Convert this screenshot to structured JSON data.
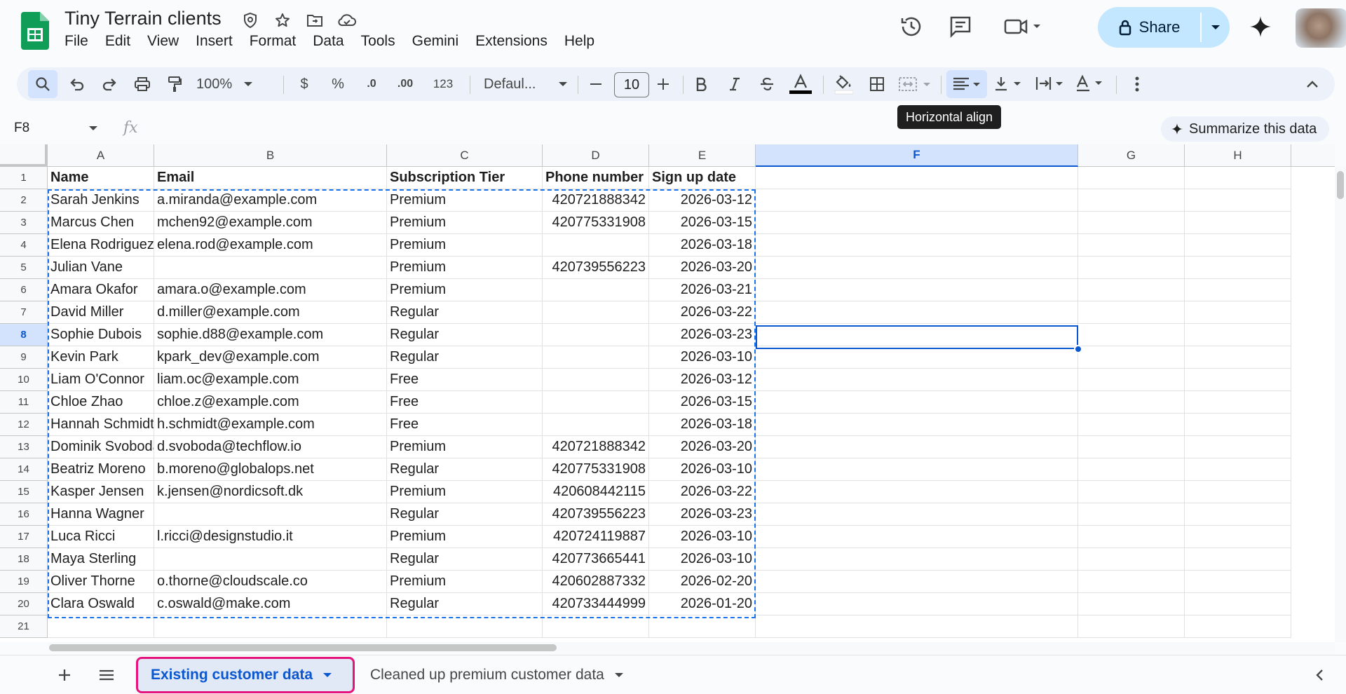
{
  "app": {
    "title": "Tiny Terrain clients",
    "menu": [
      "File",
      "Edit",
      "View",
      "Insert",
      "Format",
      "Data",
      "Tools",
      "Gemini",
      "Extensions",
      "Help"
    ],
    "share_label": "Share",
    "accent": "#0b57d0"
  },
  "toolbar": {
    "zoom": "100%",
    "currency": "$",
    "percent": "%",
    "dec_decrease": ".0",
    "dec_increase": ".00",
    "number_format": "123",
    "font": "Defaul...",
    "font_size": "10",
    "tooltip": "Horizontal align"
  },
  "formula_bar": {
    "cell_ref": "F8",
    "fx": "fx",
    "summarize_label": "Summarize this data"
  },
  "grid": {
    "columns": [
      "A",
      "B",
      "C",
      "D",
      "E",
      "F",
      "G",
      "H"
    ],
    "selected_column": "F",
    "selected_row": 8,
    "row_numbers": [
      "1",
      "2",
      "3",
      "4",
      "5",
      "6",
      "7",
      "8",
      "9",
      "10",
      "11",
      "12",
      "13",
      "14",
      "15",
      "16",
      "17",
      "18",
      "19",
      "20",
      "21"
    ],
    "header": [
      "Name",
      "Email",
      "Subscription Tier",
      "Phone number",
      "Sign up date"
    ],
    "rows": [
      [
        "Sarah Jenkins",
        "a.miranda@example.com",
        "Premium",
        "420721888342",
        "2026-03-12"
      ],
      [
        "Marcus Chen",
        "mchen92@example.com",
        "Premium",
        "420775331908",
        "2026-03-15"
      ],
      [
        "Elena Rodriguez",
        "elena.rod@example.com",
        "Premium",
        "",
        "2026-03-18"
      ],
      [
        "Julian Vane",
        "",
        "Premium",
        "420739556223",
        "2026-03-20"
      ],
      [
        "Amara Okafor",
        "amara.o@example.com",
        "Premium",
        "",
        "2026-03-21"
      ],
      [
        "David Miller",
        "d.miller@example.com",
        "Regular",
        "",
        "2026-03-22"
      ],
      [
        "Sophie Dubois",
        "sophie.d88@example.com",
        "Regular",
        "",
        "2026-03-23"
      ],
      [
        "Kevin Park",
        "kpark_dev@example.com",
        "Regular",
        "",
        "2026-03-10"
      ],
      [
        "Liam O'Connor",
        "liam.oc@example.com",
        "Free",
        "",
        "2026-03-12"
      ],
      [
        "Chloe Zhao",
        "chloe.z@example.com",
        "Free",
        "",
        "2026-03-15"
      ],
      [
        "Hannah Schmidt",
        "h.schmidt@example.com",
        "Free",
        "",
        "2026-03-18"
      ],
      [
        "Dominik Svoboda",
        "d.svoboda@techflow.io",
        "Premium",
        "420721888342",
        "2026-03-20"
      ],
      [
        "Beatriz Moreno",
        "b.moreno@globalops.net",
        "Regular",
        "420775331908",
        "2026-03-10"
      ],
      [
        "Kasper Jensen",
        "k.jensen@nordicsoft.dk",
        "Premium",
        "420608442115",
        "2026-03-22"
      ],
      [
        "Hanna Wagner",
        "",
        "Regular",
        "420739556223",
        "2026-03-23"
      ],
      [
        "Luca Ricci",
        "l.ricci@designstudio.it",
        "Premium",
        "420724119887",
        "2026-03-10"
      ],
      [
        "Maya Sterling",
        "",
        "Regular",
        "420773665441",
        "2026-03-10"
      ],
      [
        "Oliver Thorne",
        "o.thorne@cloudscale.co",
        "Premium",
        "420602887332",
        "2026-02-20"
      ],
      [
        "Clara Oswald",
        "c.oswald@make.com",
        "Regular",
        "420733444999",
        "2026-01-20"
      ]
    ]
  },
  "sheets": [
    {
      "name": "Existing customer data",
      "active": true
    },
    {
      "name": "Cleaned up premium customer data",
      "active": false
    }
  ]
}
